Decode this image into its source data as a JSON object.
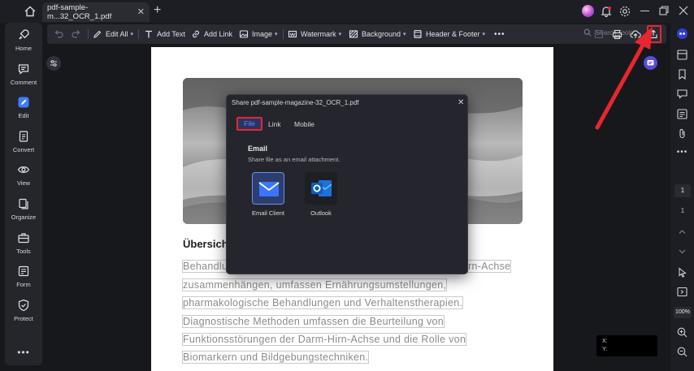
{
  "tab": {
    "title": "pdf-sample-m...32_OCR_1.pdf"
  },
  "left_rail": {
    "items": [
      {
        "label": "Home",
        "icon": "rocket-icon"
      },
      {
        "label": "Comment",
        "icon": "comment-icon"
      },
      {
        "label": "Edit",
        "icon": "edit-icon"
      },
      {
        "label": "Convert",
        "icon": "convert-icon"
      },
      {
        "label": "View",
        "icon": "eye-icon"
      },
      {
        "label": "Organize",
        "icon": "organize-icon"
      },
      {
        "label": "Tools",
        "icon": "toolbox-icon"
      },
      {
        "label": "Form",
        "icon": "form-icon"
      },
      {
        "label": "Protect",
        "icon": "shield-icon"
      }
    ],
    "more": "•••"
  },
  "toolbar": {
    "edit_all": "Edit All",
    "add_text": "Add Text",
    "add_link": "Add Link",
    "image": "Image",
    "watermark": "Watermark",
    "background": "Background",
    "header_footer": "Header & Footer",
    "more": "•••",
    "search_placeholder": "Search Tools"
  },
  "document": {
    "heading": "Übersich",
    "lines": [
      {
        "left": "Behandlu",
        "right": "rn-Achse"
      },
      {
        "full": "zusammenhängen, umfassen Ernährungsumstellungen,"
      },
      {
        "full": "pharmakologische Behandlungen und Verhaltenstherapien."
      },
      {
        "full": "Diagnostische Methoden umfassen die Beurteilung von"
      },
      {
        "full": "Funktionsstörungen der Darm-Hirn-Achse und die Rolle von"
      },
      {
        "full": "Biomarkern und Bildgebungstechniken."
      }
    ]
  },
  "coords": {
    "x_label": "X:",
    "y_label": "Y:"
  },
  "right_rail": {
    "current_page": "1",
    "total_pages": "1",
    "zoom": "100%"
  },
  "share_dialog": {
    "title": "Share pdf-sample-magazine-32_OCR_1.pdf",
    "tabs": [
      "File",
      "Link",
      "Mobile"
    ],
    "active_tab": "File",
    "section_title": "Email",
    "section_desc": "Share file as an email attachment.",
    "options": [
      {
        "label": "Email Client",
        "icon": "envelope-icon"
      },
      {
        "label": "Outlook",
        "icon": "outlook-icon"
      }
    ]
  },
  "colors": {
    "accent": "#5b8cff",
    "annotation_red": "#e8262f",
    "page_bg": "#ffffff",
    "app_bg": "#17181c"
  }
}
